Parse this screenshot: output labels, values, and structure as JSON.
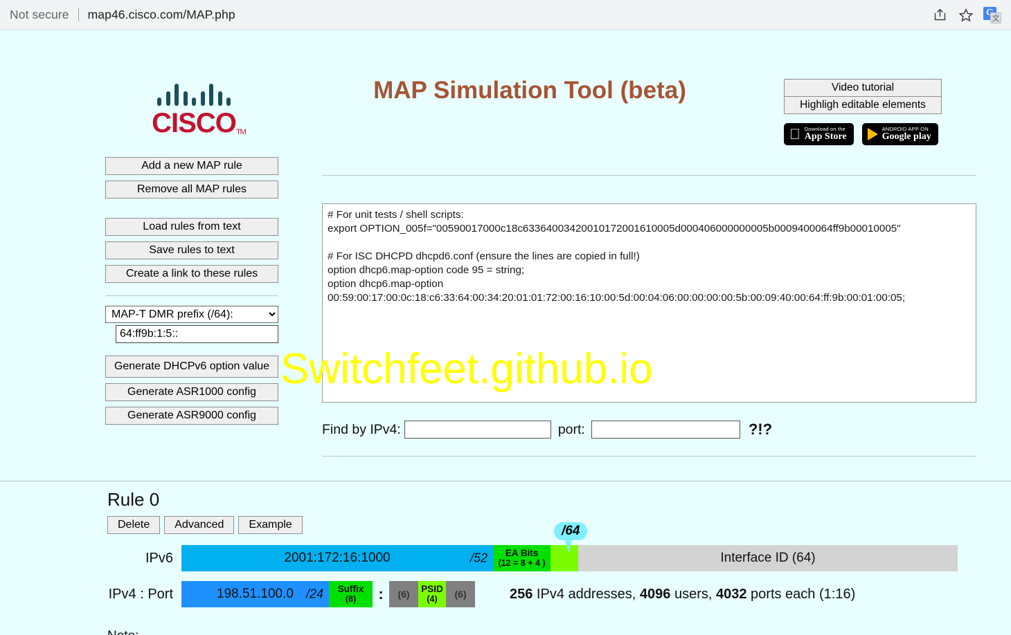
{
  "browser": {
    "security_label": "Not secure",
    "url": "map46.cisco.com/MAP.php",
    "icons": [
      "share-icon",
      "bookmark-star-icon",
      "google-translate-icon"
    ],
    "translate_letter": "G",
    "translate_sub": "文"
  },
  "header": {
    "logo_alt": "CISCO",
    "wordmark": "CISCO",
    "trademark": "TM",
    "title": "MAP Simulation Tool (beta)",
    "title_color": "#a65434",
    "video_tutorial": "Video tutorial",
    "highlight_editable": "Highligh editable elements",
    "appstore_small": "Download on the",
    "appstore_big": "App Store",
    "googleplay_small": "ANDROID APP ON",
    "googleplay_big": "Google play"
  },
  "left_panel": {
    "buttons_group1": [
      "Add a new MAP rule",
      "Remove all MAP rules"
    ],
    "buttons_group2": [
      "Load rules from text",
      "Save rules to text",
      "Create a link to these rules"
    ],
    "dmr_select_value": "MAP-T DMR prefix (/64):",
    "dmr_select_options": [
      "MAP-T DMR prefix (/64):"
    ],
    "dmr_prefix_value": "64:ff9b:1:5::",
    "buttons_group3": [
      "Generate DHCPv6 option value",
      "Generate ASR1000 config",
      "Generate ASR9000 config"
    ]
  },
  "output": {
    "text": "# For unit tests / shell scripts:\nexport OPTION_005f=\"00590017000c18c63364003420010172001610005d000406000000005b0009400064ff9b00010005\"\n\n# For ISC DHCPD dhcpd6.conf (ensure the lines are copied in full!)\noption dhcp6.map-option code 95 = string;\noption dhcp6.map-option\n00:59:00:17:00:0c:18:c6:33:64:00:34:20:01:01:72:00:16:10:00:5d:00:04:06:00:00:00:00:5b:00:09:40:00:64:ff:9b:00:01:00:05;"
  },
  "find": {
    "ipv4_label": "Find by IPv4:",
    "ipv4_value": "",
    "port_label": "port:",
    "port_value": "",
    "help": "?!?"
  },
  "rule": {
    "title": "Rule 0",
    "buttons": [
      "Delete",
      "Advanced",
      "Example"
    ],
    "ipv6_row": {
      "label": "IPv6",
      "prefix": "2001:172:16:1000",
      "prefix_len": "/52",
      "ea_title": "EA Bits",
      "ea_sub": "(12 = 8 + 4 )",
      "bubble": "/64",
      "interface_id": "Interface ID (64)"
    },
    "ipv4_row": {
      "label": "IPv4 : Port",
      "address": "198.51.100.0",
      "prefix_len": "/24",
      "suffix_title": "Suffix",
      "suffix_sub": "(8)",
      "colon": ":",
      "port_left": "(6)",
      "psid_title": "PSID",
      "psid_sub": "(4)",
      "port_right": "(6)"
    },
    "summary": {
      "addresses": "256",
      "addresses_label": " IPv4 addresses, ",
      "users": "4096",
      "users_label": " users, ",
      "ports": "4032",
      "ports_label": " ports each (1:16)"
    },
    "note_cut": "Note:"
  },
  "watermark": "Switchfeet.github.io",
  "colors": {
    "page_bg": "#e8feff",
    "cyan": "#00b0f0",
    "blue": "#1e90ff",
    "green_dark": "#00e000",
    "green_light": "#7cfc00",
    "gray": "#d3d3d3",
    "gray_dark": "#808080",
    "bubble": "#7ef0ff",
    "cisco_red": "#c4122f"
  }
}
